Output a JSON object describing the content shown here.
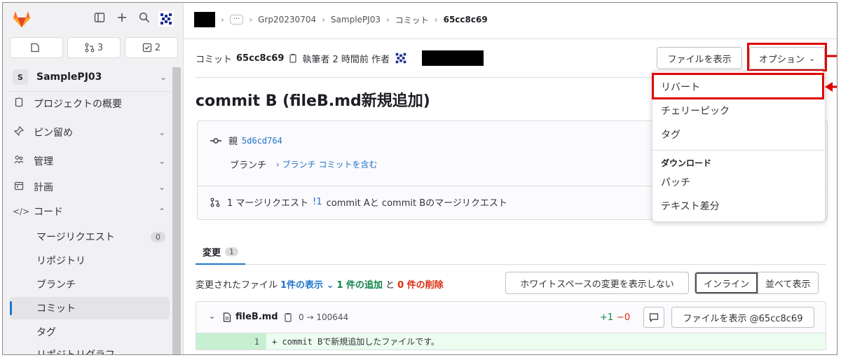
{
  "sidebar": {
    "counts": [
      {
        "icon": "issues-icon",
        "value": ""
      },
      {
        "icon": "merge-request-icon",
        "value": "3"
      },
      {
        "icon": "todo-icon",
        "value": "2"
      }
    ],
    "project_badge": "S",
    "project_name": "SamplePJ03",
    "nav": {
      "overview": "プロジェクトの概要",
      "pinned": "ピン留め",
      "manage": "管理",
      "plan": "計画",
      "code": "コード"
    },
    "code_items": {
      "mr": "マージリクエスト",
      "mr_count": "0",
      "repo": "リポジトリ",
      "branch": "ブランチ",
      "commit": "コミット",
      "tag": "タグ",
      "graph": "リポジトリグラフ"
    }
  },
  "breadcrumb": {
    "ellipsis": "···",
    "group": "Grp20230704",
    "project": "SamplePJ03",
    "commits": "コミット",
    "current": "65cc8c69"
  },
  "commit": {
    "label": "コミット",
    "sha": "65cc8c69",
    "author_text": "執筆者 2 時間前 作者",
    "browse_files": "ファイルを表示",
    "options": "オプション",
    "title": "commit B (fileB.md新規追加)",
    "parent_label": "親",
    "parent_sha": "5d6cd764",
    "branch_label": "ブランチ",
    "branch_link": "ブランチ コミットを含む",
    "mr_prefix": "1 マージリクエスト",
    "mr_link": "!1",
    "mr_text": "commit Aと commit Bのマージリクエスト"
  },
  "dropdown": {
    "revert": "リバート",
    "cherry_pick": "チェリーピック",
    "tag": "タグ",
    "download_header": "ダウンロード",
    "patch": "パッチ",
    "plain_diff": "テキスト差分"
  },
  "changes": {
    "tab_label": "変更",
    "tab_count": "1",
    "changed_files": "変更されたファイル",
    "shown": "1件の表示",
    "added": "1 件の追加",
    "and": "と",
    "deleted": "0 件の削除",
    "whitespace_btn": "ホワイトスペースの変更を表示しない",
    "inline_btn": "インライン",
    "parallel_btn": "並べて表示"
  },
  "file": {
    "name": "fileB.md",
    "mode": "0 → 100644",
    "plus": "+1",
    "minus": "−0",
    "view_btn": "ファイルを表示 @65cc8c69",
    "line_no": "1",
    "line_text": "+ commit Bで新規追加したファイルです。"
  },
  "colors": {
    "highlight": "#e00000",
    "link": "#1f75cb",
    "added": "#108548",
    "deleted": "#dd2b0e"
  }
}
